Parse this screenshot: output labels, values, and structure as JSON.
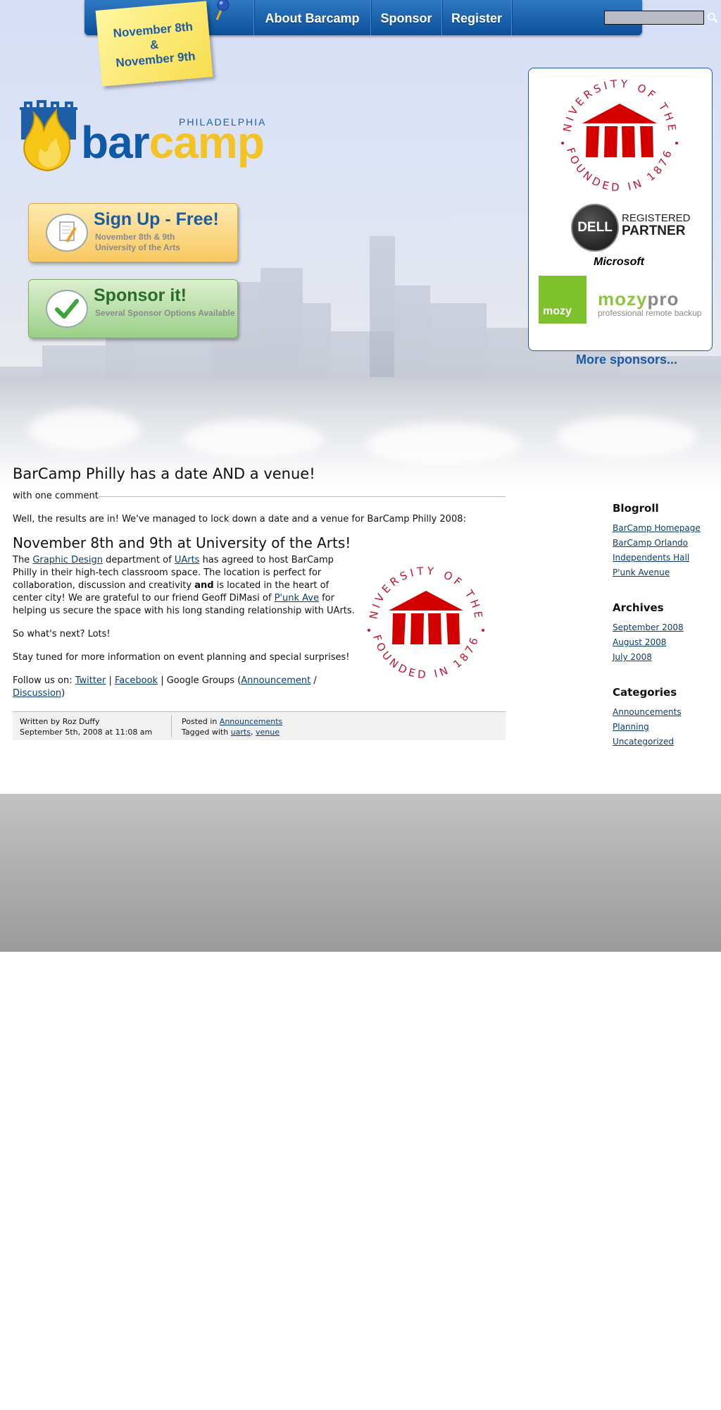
{
  "nav": {
    "date_note": "November 8th\n&\nNovember 9th",
    "items": [
      "About Barcamp",
      "Sponsor",
      "Register"
    ],
    "search_placeholder": ""
  },
  "logo": {
    "city": "PHILADELPHIA",
    "word_bar": "bar",
    "word_camp": "camp"
  },
  "promos": {
    "signup": {
      "title": "Sign Up - Free!",
      "sub1": "November 8th & 9th",
      "sub2": "University of the Arts"
    },
    "sponsor": {
      "title": "Sponsor it!",
      "sub": "Several Sponsor Options Available"
    }
  },
  "sponsors": {
    "uarts_top": "THE UNIVERSITY OF THE ARTS",
    "uarts_bottom": "FOUNDED IN 1876",
    "dell_mark": "DELL",
    "dell_line1": "REGISTERED",
    "dell_line2": "PARTNER",
    "microsoft": "Microsoft",
    "mozy_box": "mozy",
    "mozypro_a": "mozy",
    "mozypro_b": "pro",
    "mozypro_tag": "professional remote backup",
    "more": "More sponsors..."
  },
  "post": {
    "title": "BarCamp Philly has a date AND a venue!",
    "comments": "with one comment",
    "intro": "Well, the results are in! We've managed to lock down a date and a venue for BarCamp Philly 2008:",
    "subtitle": "November 8th and 9th at University of the Arts!",
    "p1_a": "The ",
    "link_graphic": "Graphic Design",
    "p1_b": " department of ",
    "link_uarts": "UArts",
    "p1_c": " has agreed to host BarCamp Philly in their high-tech classroom space. The location is perfect for collaboration, discussion and creativity ",
    "p1_bold": "and",
    "p1_d": " is located in the heart of center city! We are grateful to our friend Geoff DiMasi of ",
    "link_punk": "P'unk Ave",
    "p1_e": " for helping us secure the space with his long standing relationship with UArts.",
    "p2": "So what's next? Lots!",
    "p3": "Stay tuned for more information on event planning and special surprises!",
    "follow": "Follow us on: ",
    "link_twitter": "Twitter",
    "sep1": " | ",
    "link_facebook": "Facebook",
    "google": " | Google Groups (",
    "link_announcement": "Announcement",
    "slash": " / ",
    "link_discussion": "Discussion",
    "close": ")",
    "footer": {
      "author": "Written by Roz Duffy",
      "date": "September 5th, 2008 at 11:08 am",
      "posted_in": "Posted in ",
      "category": "Announcements",
      "tagged": "Tagged with ",
      "tag1": "uarts",
      "comma": ", ",
      "tag2": "venue"
    }
  },
  "sidebar": {
    "blogroll": {
      "heading": "Blogroll",
      "items": [
        "BarCamp Homepage",
        "BarCamp Orlando",
        "Independents Hall",
        "P'unk Avenue"
      ]
    },
    "archives": {
      "heading": "Archives",
      "items": [
        "September 2008",
        "August 2008",
        "July 2008"
      ]
    },
    "categories": {
      "heading": "Categories",
      "items": [
        "Announcements",
        "Planning",
        "Uncategorized"
      ]
    }
  },
  "colors": {
    "nav_blue": "#0b4f9b",
    "link": "#0b3d6e",
    "uarts_red": "#d40000",
    "bar_blue": "#0f5aa6",
    "camp_yellow": "#f3c323",
    "mozy_green": "#7dc12c"
  }
}
